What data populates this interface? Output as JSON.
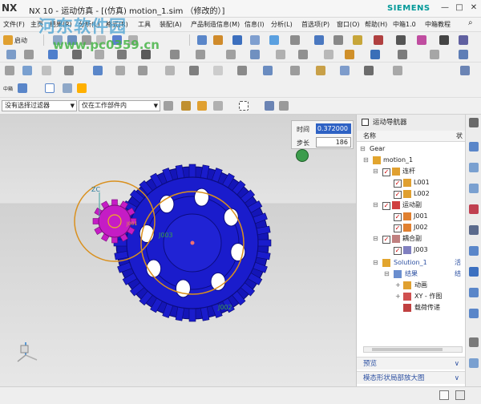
{
  "titlebar": {
    "logo": "NX",
    "title": "NX 10 - 运动仿真 - [(仿真) motion_1.sim （修改的）]",
    "brand": "SIEMENS",
    "minimize": "—",
    "maximize": "□",
    "close": "✕"
  },
  "watermark": {
    "site_name": "河东软件园",
    "url": "www.pc0359.cn"
  },
  "menubar": {
    "items": [
      "文件(F)",
      "主页",
      "结果(R)",
      "分析(L)",
      "格式(R)",
      "工具",
      "装配(A)",
      "产品制造信息(M)",
      "信息(I)",
      "分析(L)",
      "首选项(P)",
      "窗口(O)",
      "帮助(H)",
      "中箱1.0",
      "中箱教程"
    ],
    "search": "⌕"
  },
  "toolbar": {
    "start_label": "启动",
    "part_label": "中箱"
  },
  "selection_bar": {
    "filter": "没有选择过滤器",
    "scope": "仅在工作部件内"
  },
  "animation": {
    "time_label": "时间",
    "time_value": "0.372000",
    "step_label": "步长",
    "step_value": "186"
  },
  "graphics": {
    "zc_label": "ZC",
    "joint_j003": "J003",
    "joint_j002": "J002",
    "joint_j001": "J001"
  },
  "navigator": {
    "title": "运动导航器",
    "col_name": "名称",
    "col_status": "状",
    "tree": [
      {
        "label": "Gear",
        "status": ""
      },
      {
        "label": "motion_1",
        "status": ""
      },
      {
        "label": "连杆",
        "status": ""
      },
      {
        "label": "L001",
        "status": ""
      },
      {
        "label": "L002",
        "status": ""
      },
      {
        "label": "运动副",
        "status": ""
      },
      {
        "label": "J001",
        "status": ""
      },
      {
        "label": "J002",
        "status": ""
      },
      {
        "label": "耦合副",
        "status": ""
      },
      {
        "label": "J003",
        "status": ""
      },
      {
        "label": "Solution_1",
        "status": "活"
      },
      {
        "label": "结果",
        "status": "结"
      },
      {
        "label": "动画",
        "status": ""
      },
      {
        "label": "XY - 作图",
        "status": ""
      },
      {
        "label": "载荷传递",
        "status": ""
      }
    ],
    "preview_label": "预览",
    "model_view_label": "模态形状局部放大图"
  },
  "colors": {
    "gear_blue": "#1a1ccc",
    "pinion_magenta": "#c51cc5",
    "motion_orange": "#d9901e",
    "link_accent": "#2b4fa1"
  }
}
